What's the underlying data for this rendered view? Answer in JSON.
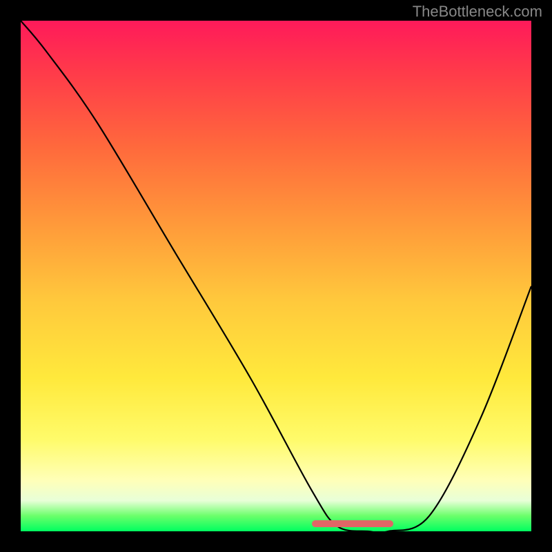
{
  "watermark": "TheBottleneck.com",
  "chart_data": {
    "type": "line",
    "title": "",
    "xlabel": "",
    "ylabel": "",
    "xlim": [
      0,
      100
    ],
    "ylim": [
      0,
      100
    ],
    "background": "red-yellow-green vertical gradient (high=red, low=green)",
    "series": [
      {
        "name": "bottleneck-curve",
        "x": [
          0,
          5,
          15,
          30,
          45,
          57,
          62,
          68,
          72,
          80,
          90,
          100
        ],
        "y": [
          100,
          94,
          80,
          55,
          30,
          8,
          1,
          0,
          0,
          3,
          22,
          48
        ]
      }
    ],
    "optimal_range": {
      "x_start": 57,
      "x_end": 73
    },
    "annotations": []
  }
}
